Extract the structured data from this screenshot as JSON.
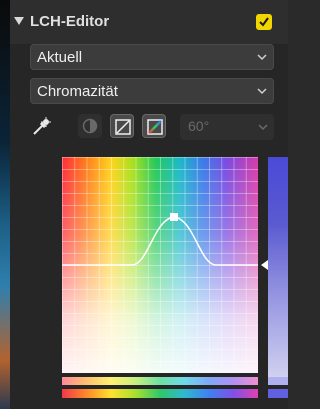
{
  "panel": {
    "title": "LCH-Editor",
    "enabled": true,
    "accent_color": "#f2d600"
  },
  "preset_select": {
    "value": "Aktuell"
  },
  "mode_select": {
    "value": "Chromazität"
  },
  "toolbar": {
    "icons": [
      "eyedropper-icon",
      "split-circle-icon",
      "slash-square-icon",
      "rainbow-slash-icon"
    ],
    "hue_width": {
      "value": "60°",
      "disabled": true
    }
  }
}
